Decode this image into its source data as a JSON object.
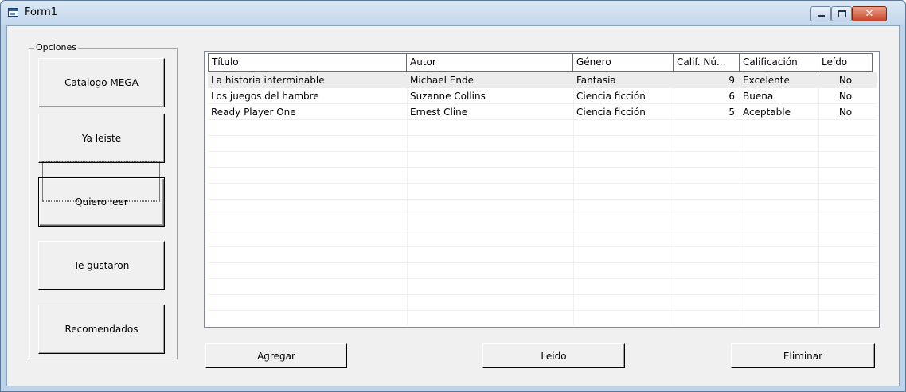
{
  "window": {
    "title": "Form1",
    "controls": {
      "minimize_icon": "minimize-icon",
      "maximize_icon": "maximize-icon",
      "close_icon": "close-icon",
      "close_glyph": "✕"
    }
  },
  "options": {
    "label": "Opciones",
    "buttons": [
      "Catalogo MEGA",
      "Ya leiste",
      "Quiero leer",
      "Te gustaron",
      "Recomendados"
    ]
  },
  "list": {
    "columns": [
      "Título",
      "Autor",
      "Género",
      "Calif. Nú...",
      "Calificación",
      "Leído"
    ],
    "rows": [
      [
        "La historia interminable",
        "Michael Ende",
        "Fantasía",
        "9",
        "Excelente",
        "No"
      ],
      [
        "Los juegos del hambre",
        "Suzanne Collins",
        "Ciencia ficción",
        "6",
        "Buena",
        "No"
      ],
      [
        "Ready Player One",
        "Ernest Cline",
        "Ciencia ficción",
        "5",
        "Aceptable",
        "No"
      ]
    ],
    "selected_row": 0
  },
  "actions": {
    "add_label": "Agregar",
    "read_label": "Leido",
    "delete_label": "Eliminar"
  },
  "colors": {
    "titlebar": "#c9dcef",
    "close": "#c8452a",
    "client": "#f0f0f0"
  }
}
